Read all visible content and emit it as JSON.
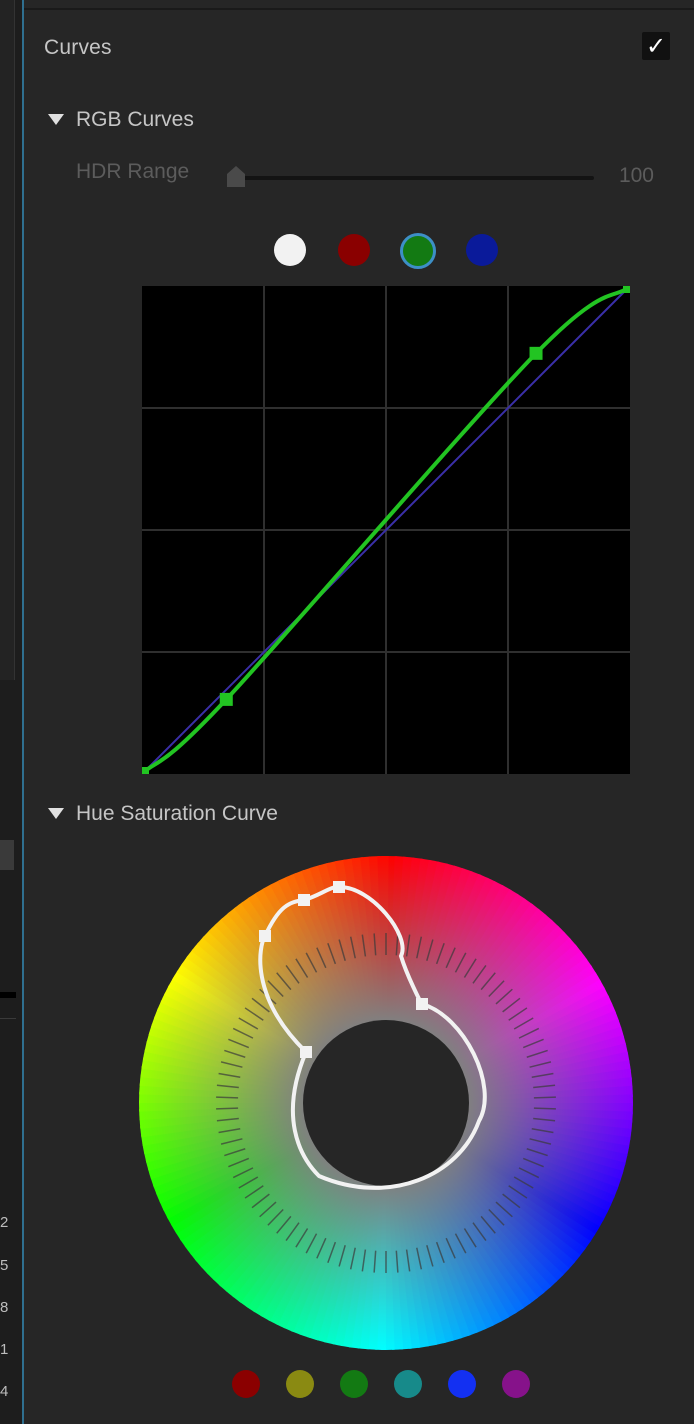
{
  "panel": {
    "title": "Curves",
    "enabled_mark": "✓"
  },
  "rgb_curves": {
    "label": "RGB Curves",
    "hdr_range": {
      "label": "HDR Range",
      "value": "100"
    },
    "channels": [
      {
        "name": "white",
        "color": "#f2f2f2"
      },
      {
        "name": "red",
        "color": "#8a0000"
      },
      {
        "name": "green",
        "color": "#137a13",
        "selected": true
      },
      {
        "name": "blue",
        "color": "#0a1a9a"
      }
    ],
    "curve_color": "#22c422",
    "reference_line_color": "#3a2fa8",
    "grid_divisions": 4,
    "control_points": [
      {
        "input": 0.0,
        "output": 0.0
      },
      {
        "input": 0.17,
        "output": 0.15
      },
      {
        "input": 0.81,
        "output": 0.865
      },
      {
        "input": 1.0,
        "output": 1.0
      }
    ]
  },
  "hue_saturation": {
    "label": "Hue Saturation Curve",
    "curve_color": "#f2f2f2",
    "swatches": [
      {
        "name": "red",
        "color": "#8b0000"
      },
      {
        "name": "yellow",
        "color": "#8a8a12"
      },
      {
        "name": "green",
        "color": "#137a13"
      },
      {
        "name": "cyan",
        "color": "#178a8a"
      },
      {
        "name": "blue",
        "color": "#1330f2"
      },
      {
        "name": "magenta",
        "color": "#86128a"
      }
    ]
  },
  "edge_numbers": [
    "2",
    "5",
    "8",
    "1",
    "4"
  ]
}
